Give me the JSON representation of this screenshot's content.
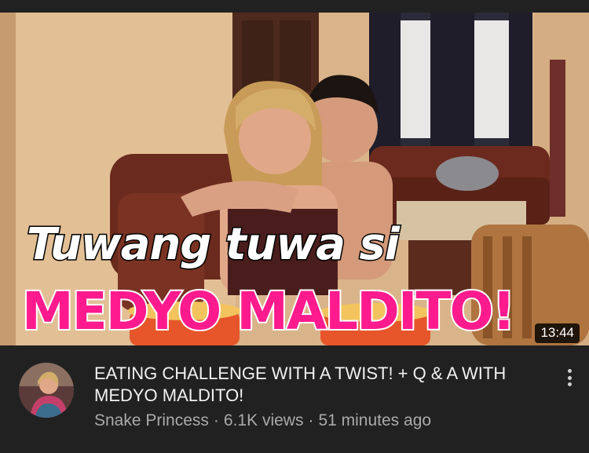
{
  "video": {
    "thumbnail_caption_line1": "Tuwang tuwa si",
    "thumbnail_caption_line2": "MEDYO MALDITO!",
    "duration": "13:44",
    "watch_progress_fraction": 0.8,
    "title": "EATING CHALLENGE WITH A TWIST! + Q & A WITH MEDYO MALDITO!",
    "channel": "Snake Princess",
    "separator": "·",
    "views": "6.1K views",
    "published": "51 minutes ago"
  },
  "icons": {
    "menu": "more-vert-icon"
  },
  "colors": {
    "background": "#212121",
    "caption_pink": "#ff1b8d",
    "progress_red": "#ff0000",
    "secondary_text": "#aaaaaa"
  }
}
